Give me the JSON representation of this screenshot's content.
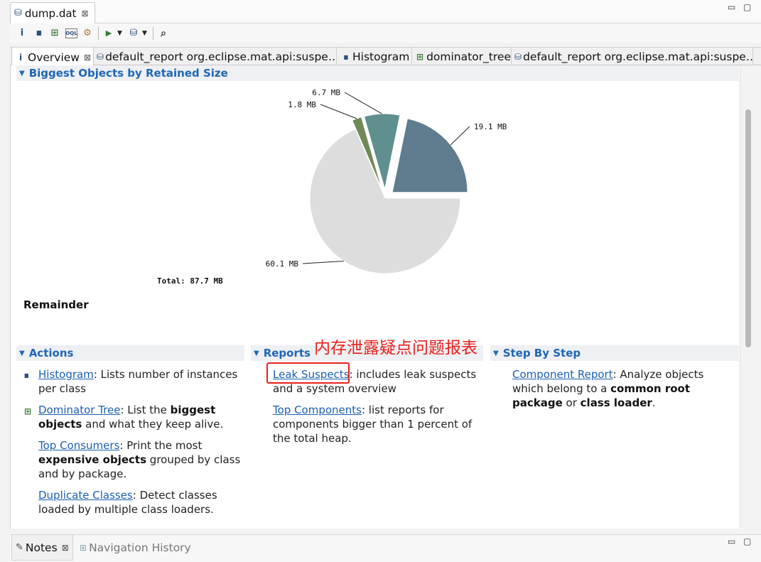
{
  "editor": {
    "tab_title": "dump.dat",
    "tab_icon": "database-icon",
    "close_glyph": "⊠",
    "minimize_glyph": "▭",
    "maximize_glyph": "▢"
  },
  "toolbar": {
    "buttons": [
      {
        "name": "info-icon",
        "glyph": "i"
      },
      {
        "name": "histogram-icon",
        "glyph": "▮▮"
      },
      {
        "name": "dominator-tree-icon",
        "glyph": "⊞"
      },
      {
        "name": "oql-icon",
        "glyph": "OQL"
      },
      {
        "name": "heap-dump-overview-icon",
        "glyph": "⚙"
      },
      {
        "name": "run-report-icon",
        "glyph": "▶"
      },
      {
        "name": "query-browser-icon",
        "glyph": "⛁"
      },
      {
        "name": "search-icon",
        "glyph": "🔍"
      }
    ],
    "dropdown_glyph": "▼"
  },
  "inner_tabs": [
    {
      "label": "Overview",
      "icon_glyph": "i",
      "icon_name": "info-icon",
      "active": true
    },
    {
      "label": "default_report  org.eclipse.mat.api:suspe…",
      "icon_glyph": "⛁",
      "icon_name": "report-icon",
      "active": false
    },
    {
      "label": "Histogram",
      "icon_glyph": "▮▮",
      "icon_name": "histogram-icon",
      "active": false
    },
    {
      "label": "dominator_tree",
      "icon_glyph": "⊞",
      "icon_name": "dominator-tree-icon",
      "active": false
    },
    {
      "label": "default_report  org.eclipse.mat.api:suspe…",
      "icon_glyph": "⛁",
      "icon_name": "report-icon",
      "active": false
    }
  ],
  "overview": {
    "biggest_objects_title": "Biggest Objects by Retained Size",
    "total_label": "Total: 87.7 MB",
    "remainder_label": "Remainder"
  },
  "chart_data": {
    "type": "pie",
    "title": "Biggest Objects by Retained Size",
    "total": "Total: 87.7 MB",
    "unit": "MB",
    "slices": [
      {
        "label": "19.1 MB",
        "value": 19.1,
        "color": "#5f7d8e",
        "exploded": true
      },
      {
        "label": "6.7 MB",
        "value": 6.7,
        "color": "#5f8f8f",
        "exploded": true
      },
      {
        "label": "1.8 MB",
        "value": 1.8,
        "color": "#6f8a56",
        "exploded": true
      },
      {
        "label": "60.1 MB",
        "value": 60.1,
        "color": "#dddddd",
        "exploded": false
      }
    ]
  },
  "actions": {
    "title": "Actions",
    "items": [
      {
        "link": "Histogram",
        "text": ": Lists number of instances per class"
      },
      {
        "link": "Dominator Tree",
        "t1": ": List the ",
        "b1": "biggest objects",
        "t2": " and what they keep alive."
      },
      {
        "link": "Top Consumers",
        "t1": ": Print the most ",
        "b1": "expensive objects",
        "t2": " grouped by class and by package."
      },
      {
        "link": "Duplicate Classes",
        "text": ": Detect classes loaded by multiple class loaders."
      }
    ]
  },
  "reports": {
    "title": "Reports",
    "items": [
      {
        "link": "Leak Suspects",
        "text": ": includes leak suspects and a system overview"
      },
      {
        "link": "Top Components",
        "text": ": list reports for components bigger than 1 percent of the total heap."
      }
    ]
  },
  "step_by_step": {
    "title": "Step By Step",
    "items": [
      {
        "link": "Component Report",
        "t1": ": Analyze objects which belong to a ",
        "b1": "common root package",
        "t2": " or ",
        "b2": "class loader",
        "t3": "."
      }
    ]
  },
  "annotation": {
    "text": "内存泄露疑点问题报表",
    "color": "#e8201c"
  },
  "bottom_panel": {
    "tabs": [
      {
        "label": "Notes",
        "active": true
      },
      {
        "label": "Navigation History",
        "active": false
      }
    ]
  }
}
